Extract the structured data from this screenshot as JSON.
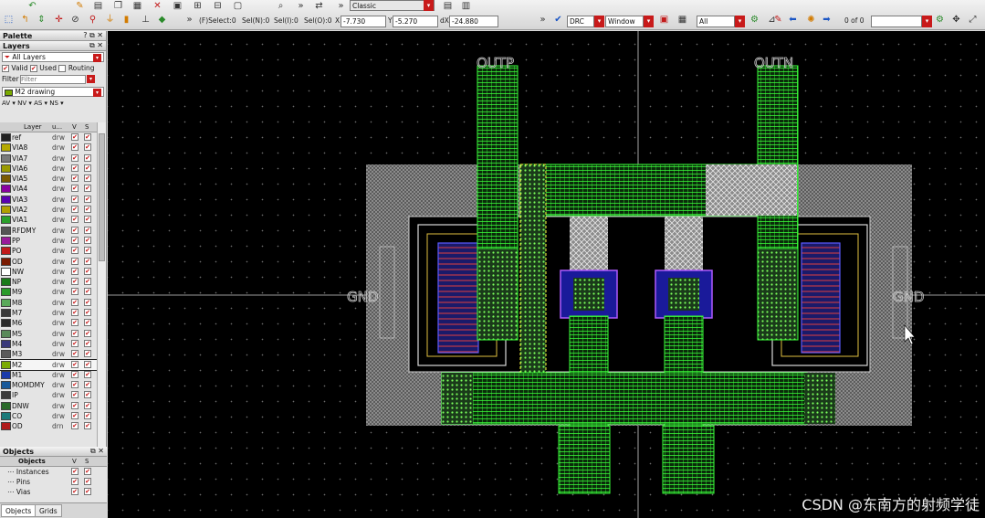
{
  "toolbar": {
    "stat_select": "(F)Select:0",
    "stat_seln": "Sel(N):0",
    "stat_seli": "Sel(I):0",
    "stat_selo": "Sel(O):0",
    "x_label": "X",
    "x_value": "-7.730",
    "y_label": "Y",
    "y_value": "-5.270",
    "dx_label": "dX",
    "dx_value": "-24.880",
    "mode_value": "Classic",
    "drc_value": "DRC",
    "window_value": "Window",
    "all_value": "All",
    "page_count": "0 of 0",
    "more_glyph": "»"
  },
  "palette": {
    "title": "Palette",
    "controls": "? ⧉ ✕",
    "layers_title": "Layers",
    "layers_controls": "⧉ ✕",
    "layer_filter_select": "All Layers",
    "valid_label": "Valid",
    "used_label": "Used",
    "routing_label": "Routing",
    "filter_label": "Filter",
    "filter_placeholder": "Filter",
    "current_layer": "M2 drawing",
    "vis_row": "AV  ▾  NV  ▾  AS  ▾  NS  ▾",
    "col_layer": "Layer",
    "col_purpose": "u...",
    "col_v": "V",
    "col_s": "S"
  },
  "layers": [
    {
      "name": "ref",
      "purpose": "drw",
      "color": "#222222"
    },
    {
      "name": "VIA8",
      "purpose": "drw",
      "color": "#b5a900"
    },
    {
      "name": "VIA7",
      "purpose": "drw",
      "color": "#7a7a7a"
    },
    {
      "name": "VIA6",
      "purpose": "drw",
      "color": "#9a9a00"
    },
    {
      "name": "VIA5",
      "purpose": "drw",
      "color": "#7a5a00"
    },
    {
      "name": "VIA4",
      "purpose": "drw",
      "color": "#8a00a0"
    },
    {
      "name": "VIA3",
      "purpose": "drw",
      "color": "#5a00b0"
    },
    {
      "name": "VIA2",
      "purpose": "drw",
      "color": "#b0a000"
    },
    {
      "name": "VIA1",
      "purpose": "drw",
      "color": "#2aa02a"
    },
    {
      "name": "RFDMY",
      "purpose": "drw",
      "color": "#555555"
    },
    {
      "name": "PP",
      "purpose": "drw",
      "color": "#9a1a9a"
    },
    {
      "name": "PO",
      "purpose": "drw",
      "color": "#c01a1a"
    },
    {
      "name": "OD",
      "purpose": "drw",
      "color": "#7a1a00"
    },
    {
      "name": "NW",
      "purpose": "drw",
      "color": "#ffffff"
    },
    {
      "name": "NP",
      "purpose": "drw",
      "color": "#1a7a1a"
    },
    {
      "name": "M9",
      "purpose": "drw",
      "color": "#2a9a2a"
    },
    {
      "name": "M8",
      "purpose": "drw",
      "color": "#5aaa5a"
    },
    {
      "name": "M7",
      "purpose": "drw",
      "color": "#3a3a3a"
    },
    {
      "name": "M6",
      "purpose": "drw",
      "color": "#2a2a2a"
    },
    {
      "name": "M5",
      "purpose": "drw",
      "color": "#5a8a5a"
    },
    {
      "name": "M4",
      "purpose": "drw",
      "color": "#3a3a7a"
    },
    {
      "name": "M3",
      "purpose": "drw",
      "color": "#5a5a5a"
    },
    {
      "name": "M2",
      "purpose": "drw",
      "color": "#7aaa00"
    },
    {
      "name": "M1",
      "purpose": "drw",
      "color": "#1a3aaa"
    },
    {
      "name": "MOMDMY",
      "purpose": "drw",
      "color": "#1a5a9a"
    },
    {
      "name": "IP",
      "purpose": "drw",
      "color": "#3a3a3a"
    },
    {
      "name": "DNW",
      "purpose": "drw",
      "color": "#2a6a2a"
    },
    {
      "name": "CO",
      "purpose": "drw",
      "color": "#1a7a7a"
    },
    {
      "name": "OD",
      "purpose": "drn",
      "color": "#b01a1a"
    }
  ],
  "objects_panel": {
    "title": "Objects",
    "controls": "⧉ ✕",
    "col_objects": "Objects",
    "col_v": "V",
    "col_s": "S",
    "items": [
      "Instances",
      "Pins",
      "Vias"
    ]
  },
  "bottom_tabs": [
    "Objects",
    "Grids"
  ],
  "canvas": {
    "pins": [
      "OUTP",
      "OUTN",
      "GND",
      "GND"
    ],
    "watermark": "CSDN @东南方的射频学徒"
  }
}
